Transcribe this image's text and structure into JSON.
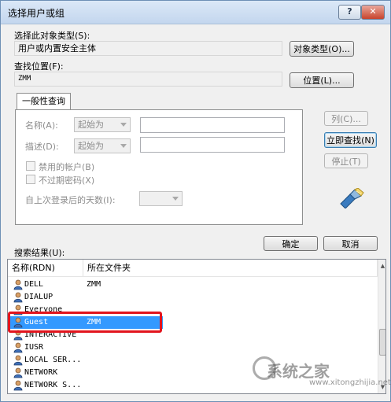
{
  "window": {
    "title": "选择用户或组",
    "help_label": "?",
    "close_label": "✕"
  },
  "object_type": {
    "label": "选择此对象类型(S):",
    "value": "用户或内置安全主体",
    "button": "对象类型(O)..."
  },
  "location": {
    "label": "查找位置(F):",
    "value": "ZMM",
    "button": "位置(L)..."
  },
  "query": {
    "tab_label": "一般性查询",
    "name_label": "名称(A):",
    "name_mode": "起始为",
    "desc_label": "描述(D):",
    "desc_mode": "起始为",
    "disabled_accounts": "禁用的帐户(B)",
    "non_expiring": "不过期密码(X)",
    "days_label": "自上次登录后的天数(I):"
  },
  "side_buttons": {
    "columns": "列(C)...",
    "find_now": "立即查找(N)",
    "stop": "停止(T)"
  },
  "dialog_buttons": {
    "ok": "确定",
    "cancel": "取消"
  },
  "results": {
    "label": "搜索结果(U):",
    "columns": [
      "名称(RDN)",
      "所在文件夹"
    ],
    "rows": [
      {
        "name": "DELL",
        "folder": "ZMM",
        "selected": false
      },
      {
        "name": "DIALUP",
        "folder": "",
        "selected": false
      },
      {
        "name": "Everyone",
        "folder": "",
        "selected": false
      },
      {
        "name": "Guest",
        "folder": "ZMM",
        "selected": true
      },
      {
        "name": "INTERACTIVE",
        "folder": "",
        "selected": false
      },
      {
        "name": "IUSR",
        "folder": "",
        "selected": false
      },
      {
        "name": "LOCAL SER...",
        "folder": "",
        "selected": false
      },
      {
        "name": "NETWORK",
        "folder": "",
        "selected": false
      },
      {
        "name": "NETWORK S...",
        "folder": "",
        "selected": false
      }
    ]
  },
  "icons": {
    "user": "user-icon",
    "search_graphic": "search-flashlight-icon"
  },
  "watermark": {
    "text": "系统之家",
    "url": "www.xitongzhijia.net"
  },
  "colors": {
    "selection": "#3399ff",
    "highlight_box": "#e2141d"
  }
}
